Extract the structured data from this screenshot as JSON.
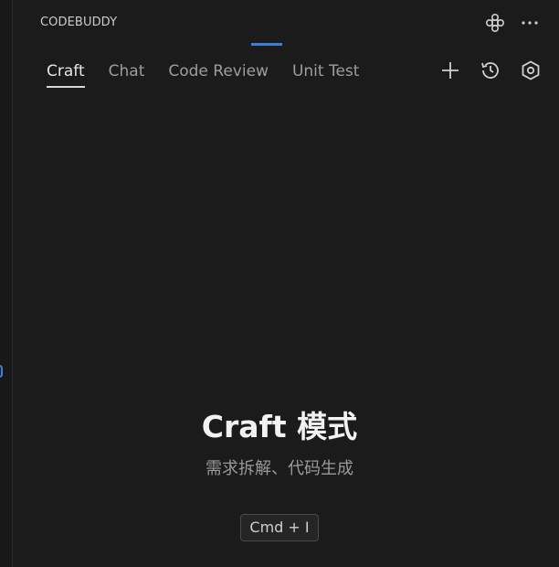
{
  "header": {
    "title": "CODEBUDDY"
  },
  "tabs": [
    {
      "label": "Craft",
      "active": true
    },
    {
      "label": "Chat",
      "active": false
    },
    {
      "label": "Code Review",
      "active": false
    },
    {
      "label": "Unit Test",
      "active": false
    }
  ],
  "icons": {
    "header": [
      "plugin-icon",
      "more-icon"
    ],
    "toolbar": [
      "add-icon",
      "history-icon",
      "settings-icon"
    ]
  },
  "hero": {
    "title": "Craft 模式",
    "subtitle": "需求拆解、代码生成"
  },
  "shortcut": {
    "label": "Cmd + I"
  },
  "colors": {
    "background": "#1b1b1c",
    "accent": "#3c7fd1",
    "text": "#cccccc"
  }
}
